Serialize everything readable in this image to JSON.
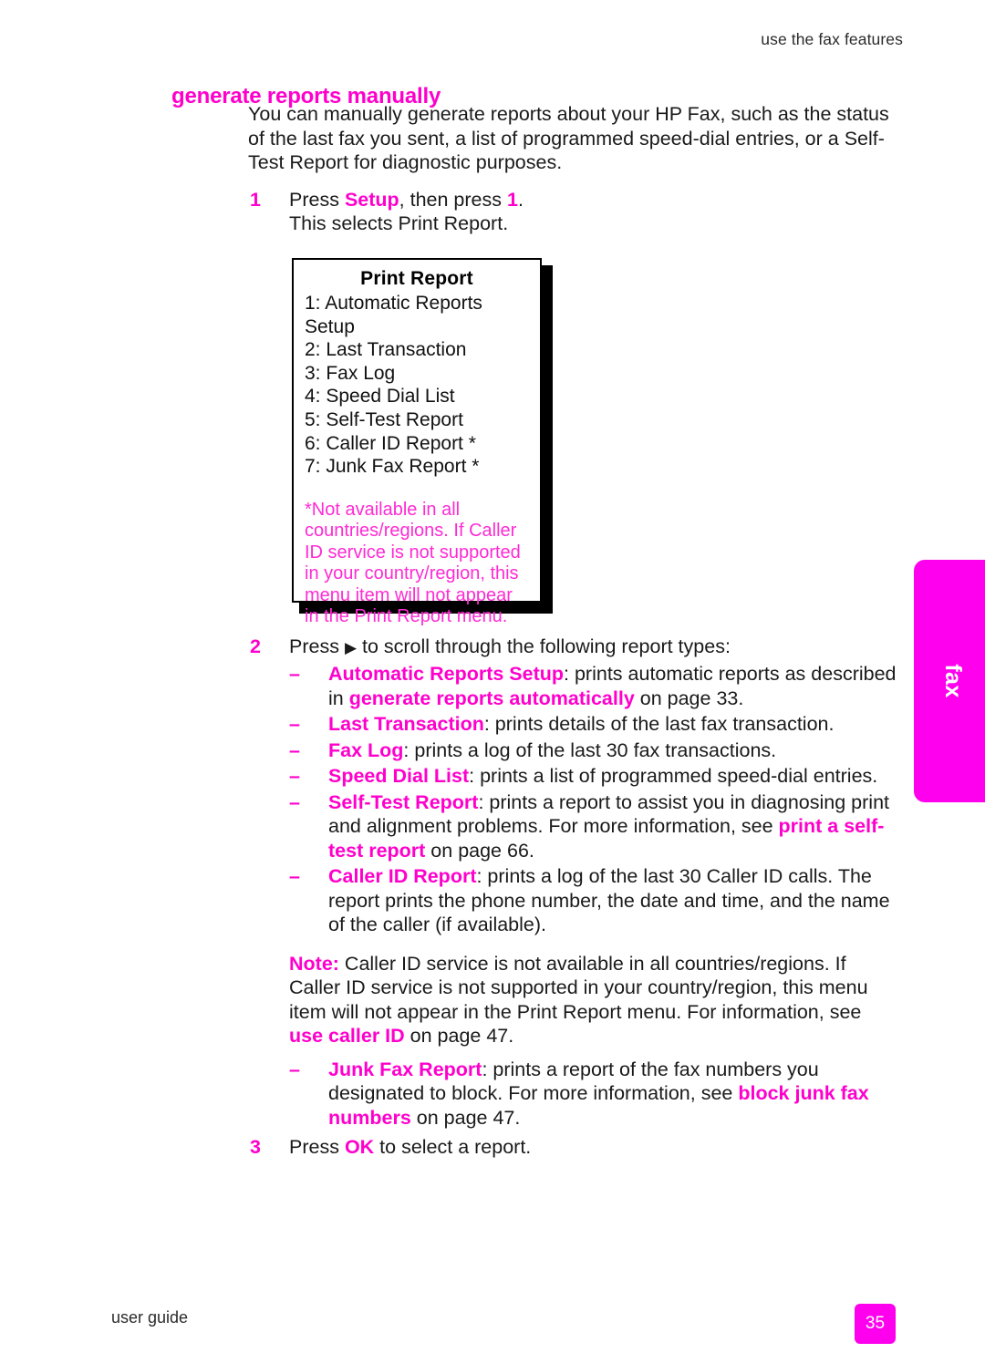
{
  "header": {
    "running_head": "use the fax features"
  },
  "heading": "generate reports manually",
  "intro": {
    "text": "You can manually generate reports about your HP Fax, such as the status of the last fax you sent, a list of programmed speed-dial entries, or a Self-Test Report for diagnostic purposes."
  },
  "steps": {
    "step1": {
      "number": "1",
      "line1_a": "Press ",
      "line1_key": "Setup",
      "line1_b": ", then press ",
      "line1_key2": "1",
      "line1_c": ".",
      "line2": "This selects Print Report."
    },
    "step2": {
      "number": "2",
      "lead_a": "Press ",
      "lead_arrow": "▶",
      "lead_b": " to scroll through the following report types:"
    },
    "step3": {
      "number": "3",
      "text_a": "Press ",
      "key": "OK",
      "text_b": " to select a report."
    }
  },
  "report_types": [
    {
      "dash": "–",
      "term": "Automatic Reports Setup",
      "desc_a": ": prints automatic reports as described in ",
      "link": "generate reports automatically",
      "desc_b": " on page 33."
    },
    {
      "dash": "–",
      "term": "Last Transaction",
      "desc_a": ": prints details of the last fax transaction.",
      "link": "",
      "desc_b": ""
    },
    {
      "dash": "–",
      "term": "Fax Log",
      "desc_a": ": prints a log of the last 30 fax transactions.",
      "link": "",
      "desc_b": ""
    },
    {
      "dash": "–",
      "term": "Speed Dial List",
      "desc_a": ": prints a list of programmed speed-dial entries.",
      "link": "",
      "desc_b": ""
    },
    {
      "dash": "–",
      "term": "Self-Test Report",
      "desc_a": ": prints a report to assist you in diagnosing print and alignment problems. For more information, see ",
      "link": "print a self-test report",
      "desc_b": " on page 66."
    },
    {
      "dash": "–",
      "term": "Caller ID Report",
      "desc_a": ": prints a log of the last 30 Caller ID calls. The report prints the phone number, the date and time, and the name of the caller (if available).",
      "link": "",
      "desc_b": ""
    }
  ],
  "note": {
    "label": "Note:",
    "text_a": " Caller ID service is not available in all countries/regions. If Caller ID service is not supported in your country/region, this menu item will not appear in the Print Report menu. For information, see ",
    "link": "use caller ID",
    "text_b": " on page 47."
  },
  "junk_fax_item": {
    "dash": "–",
    "term": "Junk Fax Report",
    "desc_a": ": prints a report of the fax numbers you designated to block. For more information, see ",
    "link": "block junk fax numbers",
    "desc_b": " on page 47."
  },
  "figure": {
    "title": "Print Report",
    "items": [
      "1: Automatic Reports Setup",
      "2: Last Transaction",
      "3: Fax Log",
      "4: Speed Dial List",
      "5: Self-Test Report",
      "6: Caller ID Report *",
      "7: Junk Fax Report *"
    ],
    "footnote": "*Not available in all countries/regions. If Caller ID service is not supported in your country/region, this menu item will not appear in the Print Report menu."
  },
  "thumb_tab": {
    "label": "fax"
  },
  "footer": {
    "guide_label": "user guide",
    "page_number": "35"
  },
  "colors": {
    "accent_magenta": "#ff00cc",
    "tab_magenta": "#ff00ee",
    "figure_note_magenta": "#ff2ad4",
    "body_text": "#1a1a1a"
  }
}
